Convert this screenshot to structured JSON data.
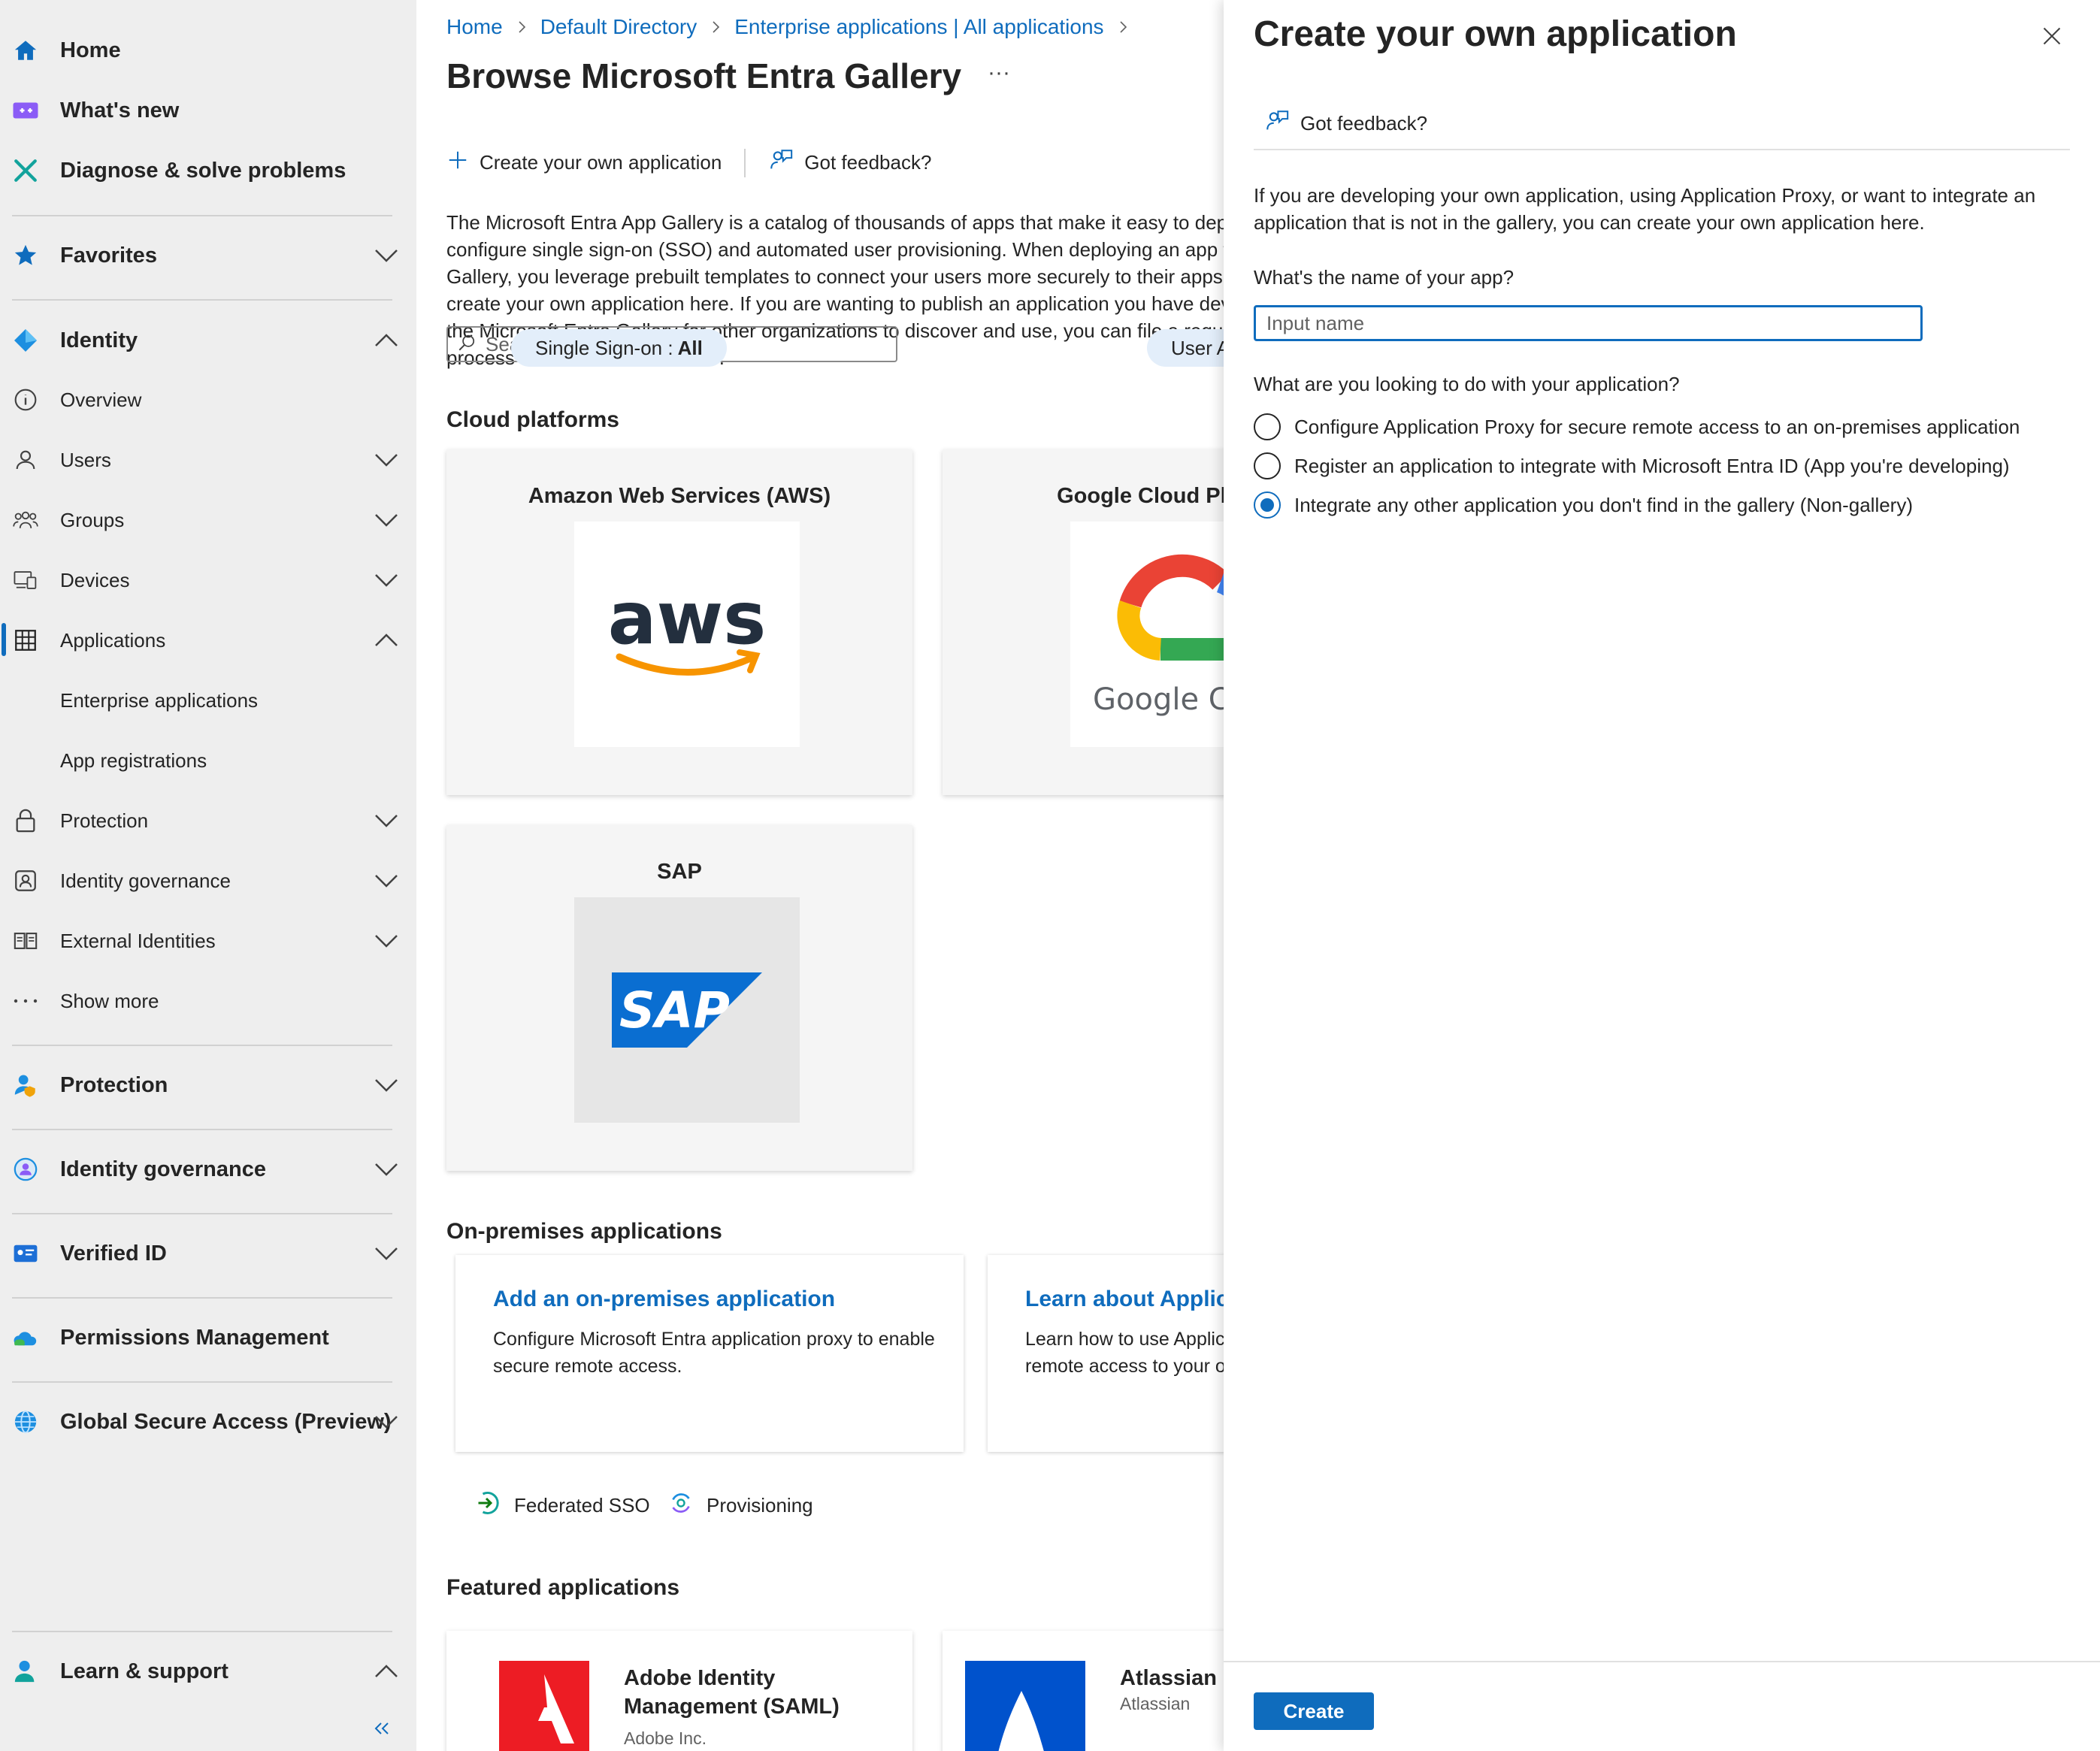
{
  "sidebar": {
    "home": "Home",
    "whats_new": "What's new",
    "diagnose": "Diagnose & solve problems",
    "favorites": "Favorites",
    "identity": "Identity",
    "overview": "Overview",
    "users": "Users",
    "groups": "Groups",
    "devices": "Devices",
    "applications": "Applications",
    "enterprise_apps": "Enterprise applications",
    "app_registrations": "App registrations",
    "protection_sub": "Protection",
    "identity_governance_sub": "Identity governance",
    "external_identities": "External Identities",
    "show_more": "Show more",
    "protection": "Protection",
    "identity_governance": "Identity governance",
    "verified_id": "Verified ID",
    "permissions_management": "Permissions Management",
    "global_secure_access": "Global Secure Access (Preview)",
    "learn_support": "Learn & support"
  },
  "breadcrumb": {
    "home": "Home",
    "directory": "Default Directory",
    "enterprise": "Enterprise applications | All applications"
  },
  "main": {
    "title": "Browse Microsoft Entra Gallery",
    "more": "···",
    "create_btn": "Create your own application",
    "feedback_btn": "Got feedback?",
    "description": "The Microsoft Entra App Gallery is a catalog of thousands of apps that make it easy to deploy and configure single sign-on (SSO) and automated user provisioning. When deploying an app from the App Gallery, you leverage prebuilt templates to connect your users more securely to their apps. Browse or create your own application here. If you are wanting to publish an application you have developed into the Microsoft Entra Gallery for other organizations to discover and use, you can file a request using the process described in this article.",
    "search_placeholder": "Search application",
    "filter_sso_label": "Single Sign-on : ",
    "filter_sso_value": "All",
    "filter_user": "User Account Management : All",
    "cloud_title": "Cloud platforms",
    "aws_title": "Amazon Web Services (AWS)",
    "aws_logo_text": "aws",
    "gcp_title": "Google Cloud Platform",
    "gcp_logo_text": "Google Cloud",
    "sap_title": "SAP",
    "sap_logo_text": "SAP",
    "onprem_title": "On-premises applications",
    "onprem_card1_title": "Add an on-premises application",
    "onprem_card1_desc": "Configure Microsoft Entra application proxy to enable secure remote access.",
    "onprem_card2_title": "Learn about Application Proxy",
    "onprem_card2_desc": "Learn how to use Application Proxy to provide secure remote access to your on-premises applications.",
    "legend_sso": "Federated SSO",
    "legend_prov": "Provisioning",
    "featured_title": "Featured applications",
    "feat1_name": "Adobe Identity Management (SAML)",
    "feat1_publisher": "Adobe Inc.",
    "feat2_name": "Atlassian Cloud",
    "feat2_publisher": "Atlassian"
  },
  "panel": {
    "title": "Create your own application",
    "feedback": "Got feedback?",
    "description": "If you are developing your own application, using Application Proxy, or want to integrate an application that is not in the gallery, you can create your own application here.",
    "name_question": "What's the name of your app?",
    "name_placeholder": "Input name",
    "purpose_question": "What are you looking to do with your application?",
    "option1": "Configure Application Proxy for secure remote access to an on-premises application",
    "option2": "Register an application to integrate with Microsoft Entra ID (App you're developing)",
    "option3": "Integrate any other application you don't find in the gallery (Non-gallery)",
    "selected_option": 3,
    "create_label": "Create"
  },
  "colors": {
    "accent": "#0f6cbd",
    "sidebar_bg": "#eeeeee"
  }
}
